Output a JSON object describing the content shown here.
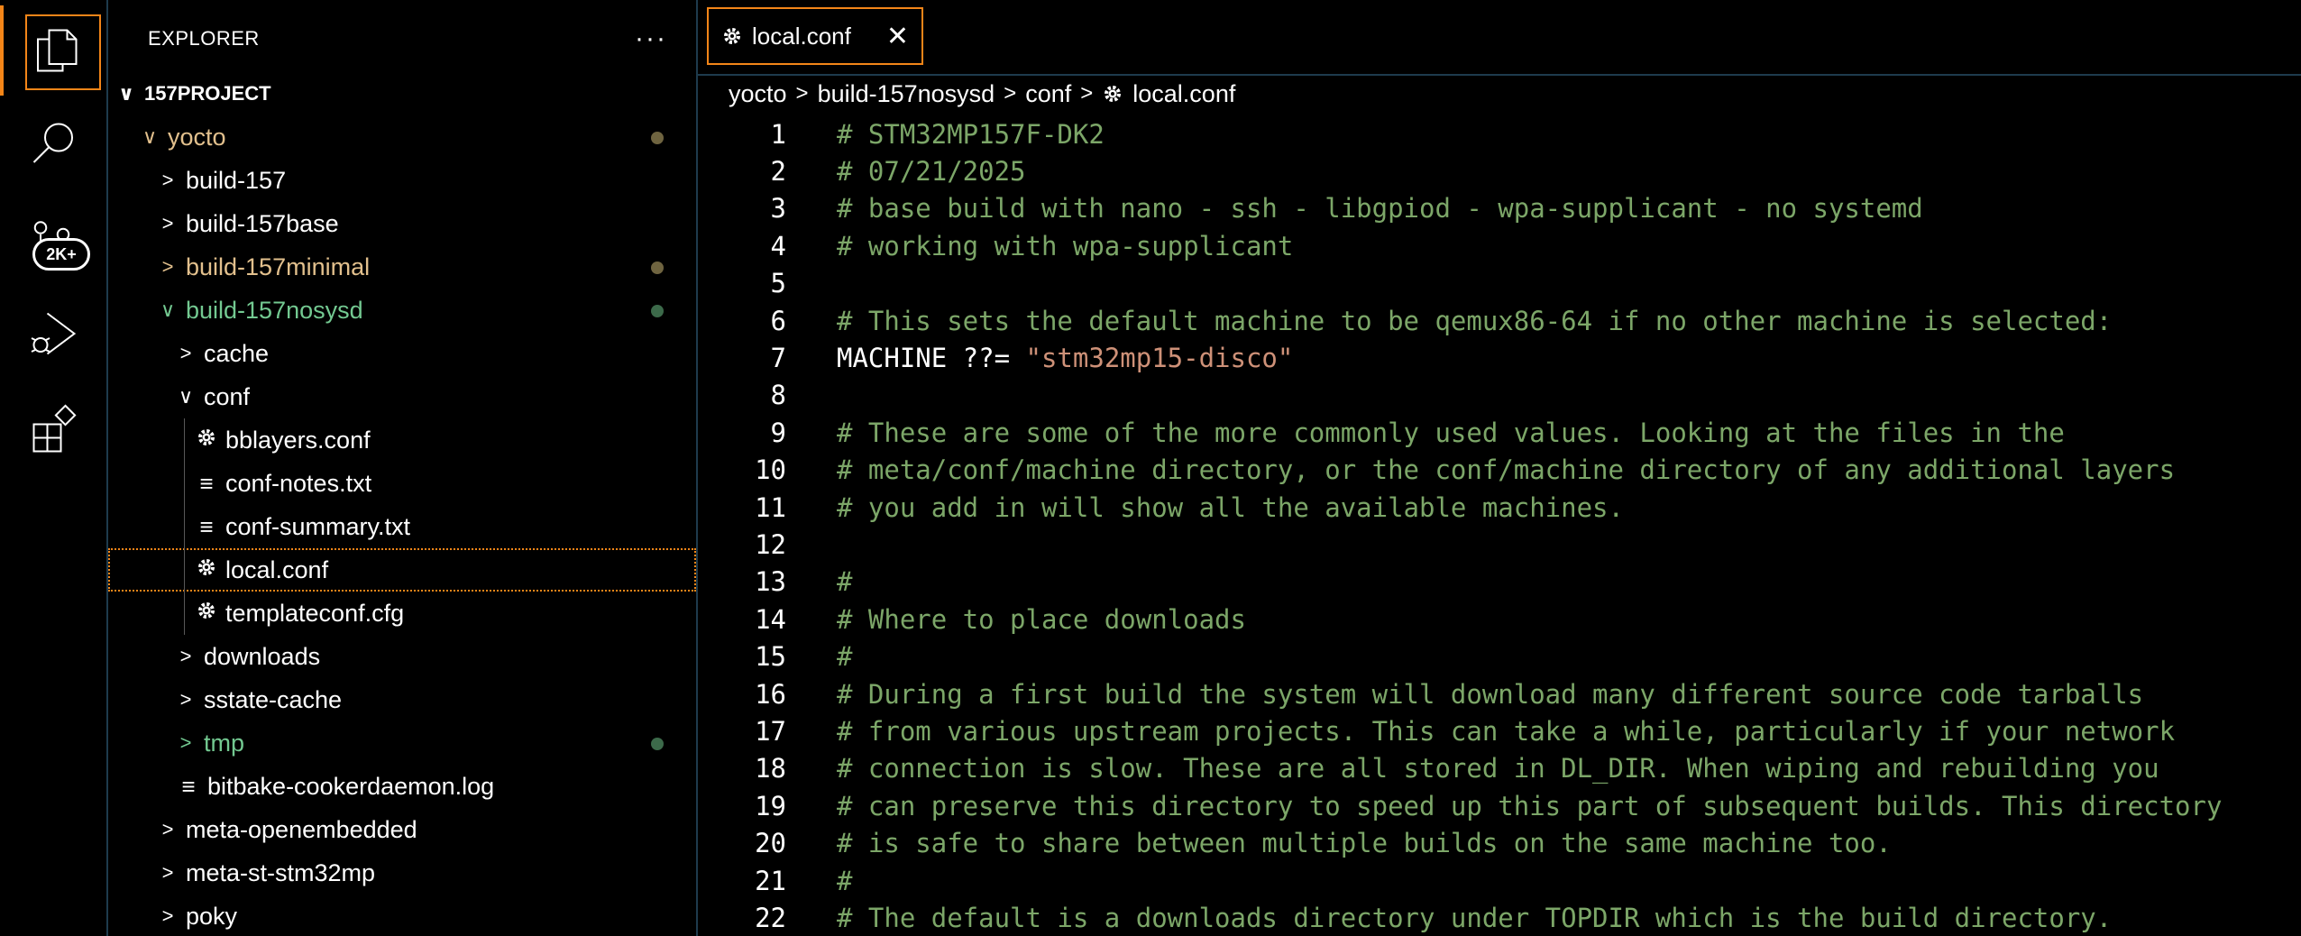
{
  "activity_bar": {
    "items": [
      {
        "name": "explorer",
        "icon": "files-icon"
      },
      {
        "name": "search",
        "icon": "search-icon"
      },
      {
        "name": "source-control",
        "icon": "source-control-icon",
        "badge": "2K+"
      },
      {
        "name": "run-debug",
        "icon": "run-debug-icon"
      },
      {
        "name": "extensions",
        "icon": "extensions-icon"
      }
    ]
  },
  "sidebar": {
    "title": "EXPLORER",
    "more": "···",
    "tree": [
      {
        "label": "157PROJECT",
        "chevron": "∨",
        "type": "root",
        "color": "default"
      },
      {
        "label": "yocto",
        "chevron": "∨",
        "type": "folder",
        "color": "modified",
        "dot": true
      },
      {
        "label": "build-157",
        "chevron": ">",
        "type": "folder",
        "color": "default"
      },
      {
        "label": "build-157base",
        "chevron": ">",
        "type": "folder",
        "color": "default"
      },
      {
        "label": "build-157minimal",
        "chevron": ">",
        "type": "folder",
        "color": "modified",
        "dot": true
      },
      {
        "label": "build-157nosysd",
        "chevron": "∨",
        "type": "folder",
        "color": "untracked",
        "dot": true
      },
      {
        "label": "cache",
        "chevron": ">",
        "type": "folder",
        "color": "default"
      },
      {
        "label": "conf",
        "chevron": "∨",
        "type": "folder",
        "color": "default"
      },
      {
        "label": "bblayers.conf",
        "icon": "gear-icon",
        "type": "file",
        "color": "default"
      },
      {
        "label": "conf-notes.txt",
        "icon": "lines-icon",
        "type": "file",
        "color": "default"
      },
      {
        "label": "conf-summary.txt",
        "icon": "lines-icon",
        "type": "file",
        "color": "default"
      },
      {
        "label": "local.conf",
        "icon": "gear-icon",
        "type": "file",
        "color": "default",
        "selected": true
      },
      {
        "label": "templateconf.cfg",
        "icon": "gear-icon",
        "type": "file",
        "color": "default"
      },
      {
        "label": "downloads",
        "chevron": ">",
        "type": "folder",
        "color": "default"
      },
      {
        "label": "sstate-cache",
        "chevron": ">",
        "type": "folder",
        "color": "default"
      },
      {
        "label": "tmp",
        "chevron": ">",
        "type": "folder",
        "color": "untracked",
        "dot": true
      },
      {
        "label": "bitbake-cookerdaemon.log",
        "icon": "lines-icon",
        "type": "file",
        "color": "default"
      },
      {
        "label": "meta-openembedded",
        "chevron": ">",
        "type": "folder",
        "color": "default"
      },
      {
        "label": "meta-st-stm32mp",
        "chevron": ">",
        "type": "folder",
        "color": "default"
      },
      {
        "label": "poky",
        "chevron": ">",
        "type": "folder",
        "color": "default"
      }
    ]
  },
  "editor": {
    "tab": {
      "label": "local.conf",
      "icon": "gear-icon",
      "close": "✕"
    },
    "breadcrumb": [
      "yocto",
      "build-157nosysd",
      "conf",
      "local.conf"
    ],
    "lines": [
      {
        "n": "1",
        "text": "# STM32MP157F-DK2",
        "kind": "comment"
      },
      {
        "n": "2",
        "text": "# 07/21/2025",
        "kind": "comment"
      },
      {
        "n": "3",
        "text": "# base build with nano - ssh - libgpiod - wpa-supplicant - no systemd",
        "kind": "comment"
      },
      {
        "n": "4",
        "text": "# working with wpa-supplicant",
        "kind": "comment"
      },
      {
        "n": "5",
        "text": "",
        "kind": "comment"
      },
      {
        "n": "6",
        "text": "# This sets the default machine to be qemux86-64 if no other machine is selected:",
        "kind": "comment"
      },
      {
        "n": "7",
        "text": "MACHINE ??= ",
        "kind": "code",
        "string": "\"stm32mp15-disco\""
      },
      {
        "n": "8",
        "text": "",
        "kind": "comment"
      },
      {
        "n": "9",
        "text": "# These are some of the more commonly used values. Looking at the files in the",
        "kind": "comment"
      },
      {
        "n": "10",
        "text": "# meta/conf/machine directory, or the conf/machine directory of any additional layers",
        "kind": "comment"
      },
      {
        "n": "11",
        "text": "# you add in will show all the available machines.",
        "kind": "comment"
      },
      {
        "n": "12",
        "text": "",
        "kind": "comment"
      },
      {
        "n": "13",
        "text": "#",
        "kind": "comment"
      },
      {
        "n": "14",
        "text": "# Where to place downloads",
        "kind": "comment"
      },
      {
        "n": "15",
        "text": "#",
        "kind": "comment"
      },
      {
        "n": "16",
        "text": "# During a first build the system will download many different source code tarballs",
        "kind": "comment"
      },
      {
        "n": "17",
        "text": "# from various upstream projects. This can take a while, particularly if your network",
        "kind": "comment"
      },
      {
        "n": "18",
        "text": "# connection is slow. These are all stored in DL_DIR. When wiping and rebuilding you",
        "kind": "comment"
      },
      {
        "n": "19",
        "text": "# can preserve this directory to speed up this part of subsequent builds. This directory",
        "kind": "comment"
      },
      {
        "n": "20",
        "text": "# is safe to share between multiple builds on the same machine too.",
        "kind": "comment"
      },
      {
        "n": "21",
        "text": "#",
        "kind": "comment"
      },
      {
        "n": "22",
        "text": "# The default is a downloads directory under TOPDIR which is the build directory.",
        "kind": "comment"
      }
    ]
  },
  "colors": {
    "accent": "#f38518",
    "comment": "#7ca668",
    "string": "#ce9178",
    "modified": "#e2c08d",
    "untracked": "#73c991"
  }
}
